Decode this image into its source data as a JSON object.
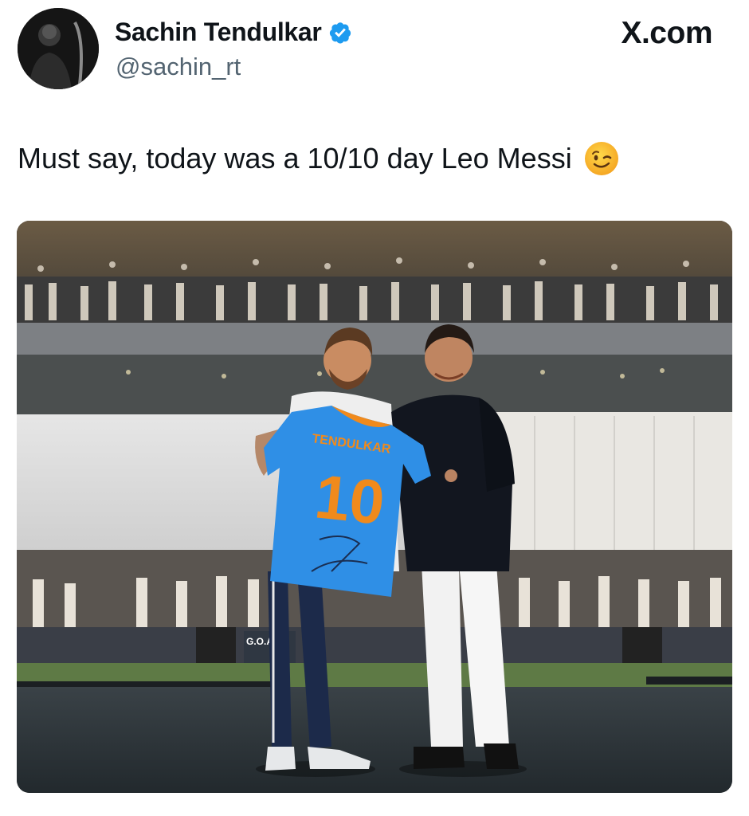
{
  "author": {
    "display_name": "Sachin Tendulkar",
    "handle": "@sachin_rt",
    "verified": true,
    "verified_color": "#1d9bf0"
  },
  "brand": {
    "label": "X.com"
  },
  "tweet": {
    "text": "Must say, today was a 10/10 day Leo Messi",
    "emoji": "winking-face"
  },
  "photo": {
    "jersey_name": "TENDULKAR",
    "jersey_number": "10",
    "banner_text": "G.O.A.T",
    "colors": {
      "jersey": "#2f8fe6",
      "jersey_number": "#f08a1c",
      "pitch": "#2b3237"
    }
  }
}
